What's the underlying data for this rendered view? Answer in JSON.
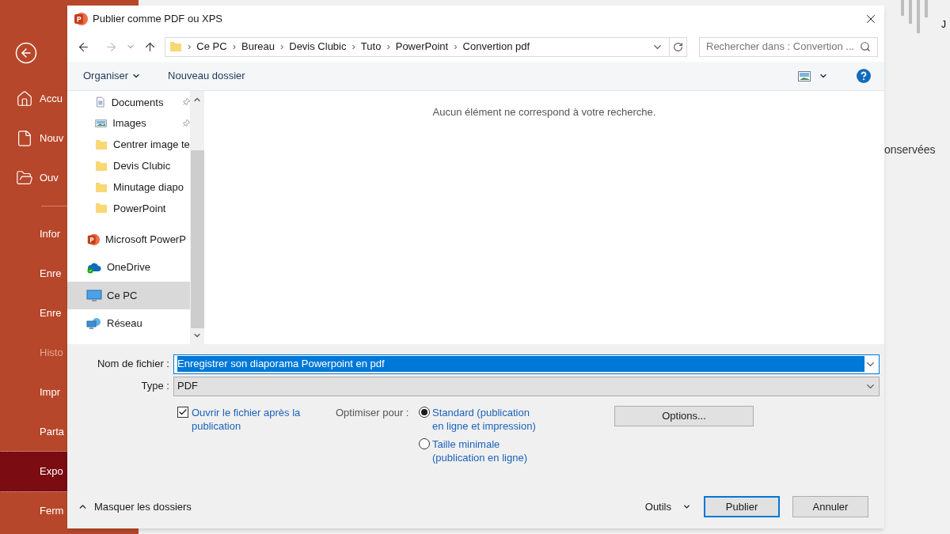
{
  "backstage": {
    "nav_top": [
      {
        "label": "Accu",
        "kind": "home",
        "selected": false,
        "disabled": false
      },
      {
        "label": "Nouv",
        "kind": "new",
        "selected": false,
        "disabled": false
      },
      {
        "label": "Ouv",
        "kind": "open",
        "selected": false,
        "disabled": false
      }
    ],
    "nav_main": [
      {
        "label": "Infor",
        "selected": false,
        "disabled": false
      },
      {
        "label": "Enre",
        "selected": false,
        "disabled": false
      },
      {
        "label": "Enre",
        "selected": false,
        "disabled": false
      },
      {
        "label": "Histo",
        "selected": false,
        "disabled": true
      },
      {
        "label": "Impr",
        "selected": false,
        "disabled": false
      },
      {
        "label": "Parta",
        "selected": false,
        "disabled": false
      },
      {
        "label": "Expo",
        "selected": true,
        "disabled": false
      },
      {
        "label": "Ferm",
        "selected": false,
        "disabled": false
      }
    ],
    "corner_text": "J",
    "side_text": "onservées"
  },
  "dialog": {
    "title": "Publier comme PDF ou XPS",
    "breadcrumbs": [
      {
        "sep": "›",
        "label": "Ce PC"
      },
      {
        "sep": "›",
        "label": "Bureau"
      },
      {
        "sep": "›",
        "label": "Devis Clubic"
      },
      {
        "sep": "›",
        "label": "Tuto"
      },
      {
        "sep": "›",
        "label": "PowerPoint"
      },
      {
        "sep": "›",
        "label": "Convertion pdf"
      }
    ],
    "search": {
      "placeholder": "Rechercher dans : Convertion ..."
    },
    "toolbar": {
      "organize": "Organiser",
      "new_folder": "Nouveau dossier"
    },
    "quick_access": [
      {
        "label": "Documents",
        "kind": "documents",
        "pinned": true
      },
      {
        "label": "Images",
        "kind": "images",
        "pinned": true
      },
      {
        "label": "Centrer image te",
        "kind": "folder",
        "pinned": false
      },
      {
        "label": "Devis Clubic",
        "kind": "folder",
        "pinned": false
      },
      {
        "label": "Minutage diapo",
        "kind": "folder",
        "pinned": false
      },
      {
        "label": "PowerPoint",
        "kind": "folder",
        "pinned": false
      }
    ],
    "locations": [
      {
        "label": "Microsoft PowerP",
        "kind": "app",
        "selected": false
      },
      {
        "label": "OneDrive",
        "kind": "cloud",
        "selected": false
      },
      {
        "label": "Ce PC",
        "kind": "pc",
        "selected": true
      },
      {
        "label": "Réseau",
        "kind": "network",
        "selected": false
      }
    ],
    "empty_message": "Aucun élément ne correspond à votre recherche.",
    "filename": {
      "label": "Nom de fichier :",
      "value": "Enregistrer son diaporama Powerpoint en pdf"
    },
    "type": {
      "label": "Type :",
      "value": "PDF"
    },
    "open_after": {
      "label": "Ouvrir le fichier après la publication",
      "checked": true
    },
    "optimize": {
      "label": "Optimiser pour :",
      "options": [
        {
          "label": "Standard (publication en ligne et impression)",
          "selected": true
        },
        {
          "label": "Taille minimale (publication en ligne)",
          "selected": false
        }
      ]
    },
    "options_button": "Options...",
    "hide_folders": "Masquer les dossiers",
    "tools": "Outils",
    "publish": "Publier",
    "cancel": "Annuler"
  }
}
